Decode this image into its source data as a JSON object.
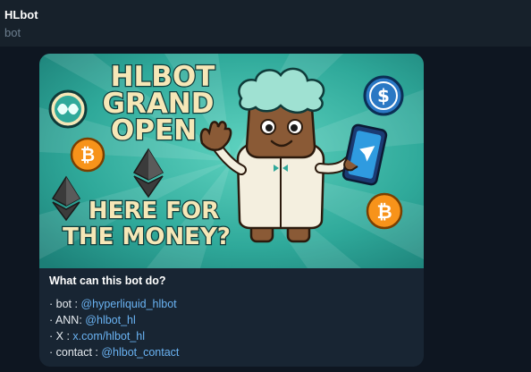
{
  "chat": {
    "name": "HLbot",
    "subtitle": "bot"
  },
  "banner": {
    "headline_1": "HLBOT",
    "headline_2": "GRAND",
    "headline_3": "OPEN",
    "tagline_1": "HERE FOR",
    "tagline_2": "THE MONEY?",
    "icons": [
      "hyperliquid-logo-icon",
      "bitcoin-icon",
      "ethereum-icon",
      "dollar-coin-icon",
      "phone-icon",
      "mascot"
    ]
  },
  "card": {
    "title": "What can this bot do?",
    "lines": [
      {
        "prefix": "· bot : ",
        "link": "@hyperliquid_hlbot"
      },
      {
        "prefix": "· ANN: ",
        "link": "@hlbot_hl"
      },
      {
        "prefix": "· X : ",
        "link": "x.com/hlbot_hl"
      },
      {
        "prefix": "· contact : ",
        "link": "@hlbot_contact"
      }
    ]
  },
  "colors": {
    "background": "#0e1621",
    "header": "#17212b",
    "bubble": "#182533",
    "link": "#6ab3f3",
    "banner_teal": "#2fa99a",
    "headline_fill": "#f6e7b7",
    "headline_stroke": "#0f3b3a"
  }
}
